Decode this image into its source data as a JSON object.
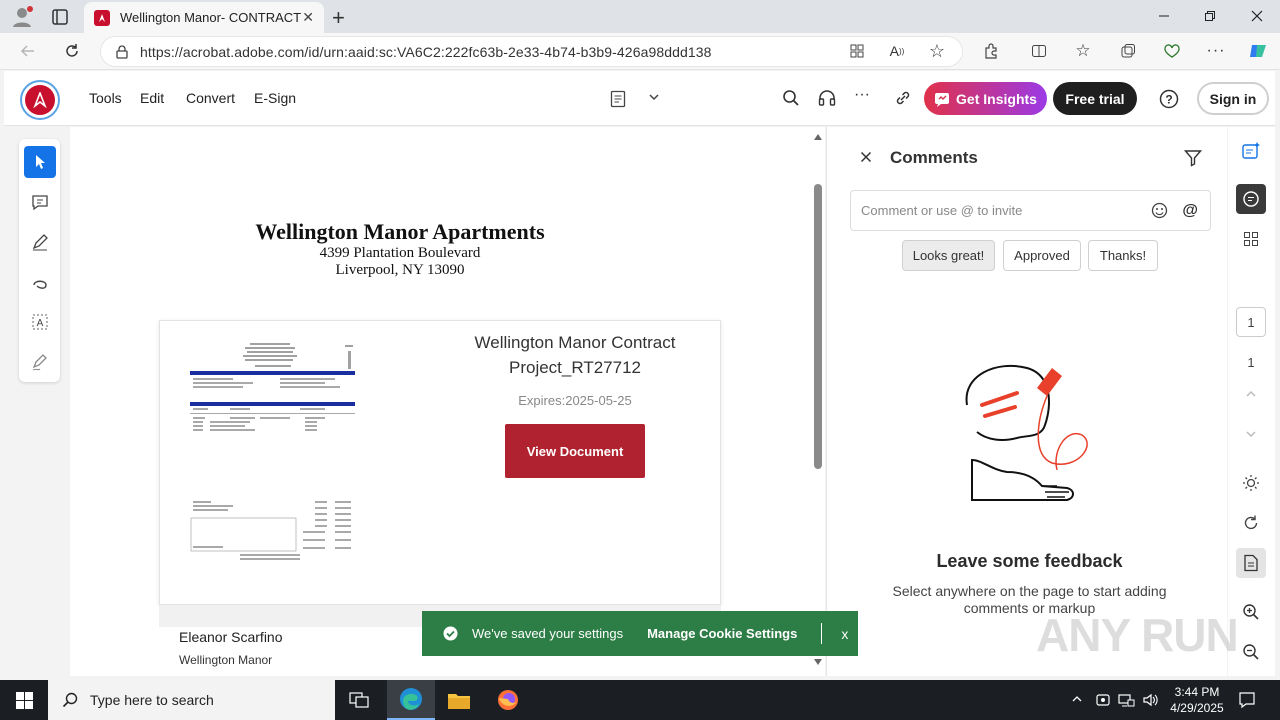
{
  "browser": {
    "tab_title": "Wellington Manor- CONTRACT P",
    "url": "https://acrobat.adobe.com/id/urn:aaid:sc:VA6C2:222fc63b-2e33-4b74-b3b9-426a98ddd138"
  },
  "acrobat": {
    "menu": [
      "Tools",
      "Edit",
      "Convert",
      "E-Sign"
    ],
    "get_insights": "Get Insights",
    "free_trial": "Free trial",
    "sign_in": "Sign in"
  },
  "document": {
    "company": "Wellington Manor Apartments",
    "address1": "4399 Plantation Boulevard",
    "address2": "Liverpool, NY 13090",
    "contract_title": "Wellington Manor Contract Project_RT27712",
    "expires": "Expires:2025-05-25",
    "view_button": "View Document",
    "signer_name": "Eleanor Scarfino",
    "signer_org": "Wellington Manor"
  },
  "comments": {
    "title": "Comments",
    "placeholder": "Comment or use @ to invite",
    "chips": [
      "Looks great!",
      "Approved",
      "Thanks!"
    ],
    "feedback_title": "Leave some feedback",
    "feedback_desc": "Select anywhere on the page to start adding comments or markup"
  },
  "rail": {
    "page_input": "1",
    "page_total": "1"
  },
  "toast": {
    "message": "We've saved your settings",
    "link": "Manage Cookie Settings",
    "close": "x"
  },
  "taskbar": {
    "search_placeholder": "Type here to search",
    "time": "3:44 PM",
    "date": "4/29/2025"
  },
  "watermark": "ANY RUN",
  "colors": {
    "accent_red": "#b0222f",
    "toast_green": "#2d7d46",
    "adobe_red": "#c8102e"
  }
}
